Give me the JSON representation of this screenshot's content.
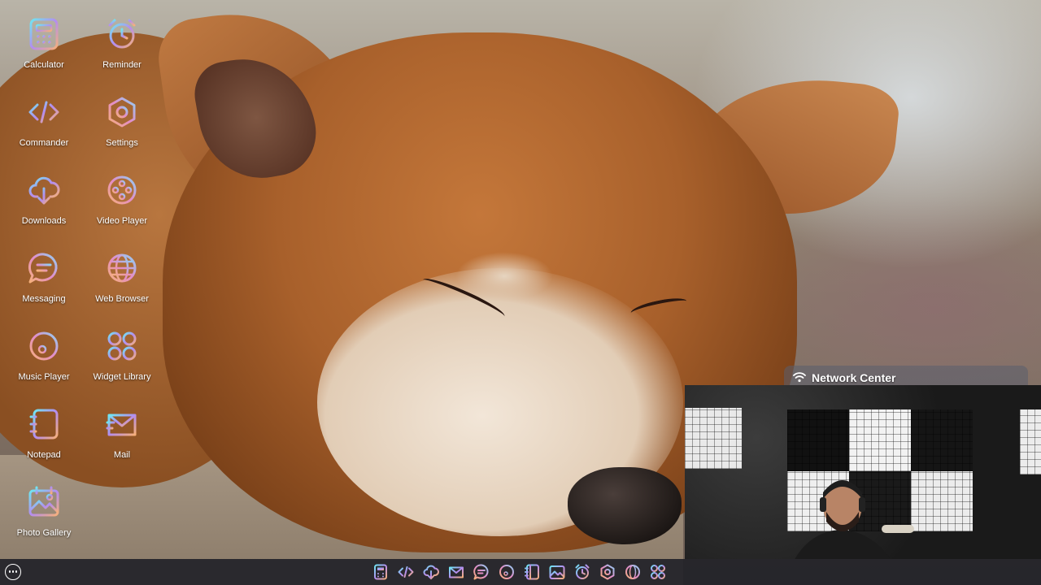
{
  "desktop": {
    "icons": [
      {
        "label": "Calculator",
        "icon": "calculator-icon"
      },
      {
        "label": "Reminder",
        "icon": "alarm-clock-icon"
      },
      {
        "label": "Commander",
        "icon": "code-icon"
      },
      {
        "label": "Settings",
        "icon": "hexagon-gear-icon"
      },
      {
        "label": "Downloads",
        "icon": "cloud-download-icon"
      },
      {
        "label": "Video Player",
        "icon": "film-reel-icon"
      },
      {
        "label": "Messaging",
        "icon": "chat-bubble-icon"
      },
      {
        "label": "Web Browser",
        "icon": "globe-icon"
      },
      {
        "label": "Music Player",
        "icon": "music-note-icon"
      },
      {
        "label": "Widget Library",
        "icon": "four-circles-icon"
      },
      {
        "label": "Notepad",
        "icon": "notebook-icon"
      },
      {
        "label": "Mail",
        "icon": "envelope-icon"
      },
      {
        "label": "Photo Gallery",
        "icon": "picture-icon"
      }
    ]
  },
  "taskbar": {
    "start_icon": "ellipsis-menu-icon",
    "apps": [
      {
        "name": "Calculator",
        "icon": "calculator-icon"
      },
      {
        "name": "Commander",
        "icon": "code-icon"
      },
      {
        "name": "Downloads",
        "icon": "cloud-download-icon"
      },
      {
        "name": "Mail",
        "icon": "envelope-icon"
      },
      {
        "name": "Messaging",
        "icon": "chat-bubble-icon"
      },
      {
        "name": "Music Player",
        "icon": "music-note-icon"
      },
      {
        "name": "Notepad",
        "icon": "notebook-icon"
      },
      {
        "name": "Photo Gallery",
        "icon": "picture-icon"
      },
      {
        "name": "Reminder",
        "icon": "alarm-clock-icon"
      },
      {
        "name": "Settings",
        "icon": "hexagon-gear-icon"
      },
      {
        "name": "Web Browser",
        "icon": "globe-icon"
      },
      {
        "name": "Widget Library",
        "icon": "four-circles-icon"
      }
    ]
  },
  "network_center": {
    "title": "Network Center",
    "icon": "wifi-icon"
  },
  "colors": {
    "icon_gradient_start": "#6ee7f2",
    "icon_gradient_mid": "#b48cf0",
    "icon_gradient_end": "#f6b07a",
    "taskbar_bg": "#1c1e26",
    "label_text": "#ffffff"
  }
}
